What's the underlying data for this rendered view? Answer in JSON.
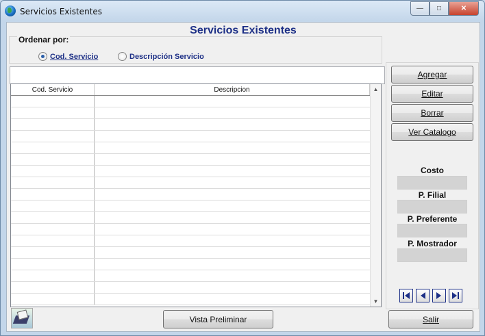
{
  "window": {
    "title": "Servicios Existentes"
  },
  "header": {
    "title": "Servicios Existentes"
  },
  "sort": {
    "label": "Ordenar por:",
    "options": [
      {
        "label": "Cod. Servicio",
        "selected": true
      },
      {
        "label": "Descripción Servicio",
        "selected": false
      }
    ]
  },
  "search": {
    "value": ""
  },
  "grid": {
    "columns": [
      "Cod. Servicio",
      "Descripcion"
    ],
    "rows": []
  },
  "actions": {
    "agregar": "Agregar",
    "editar": "Editar",
    "borrar": "Borrar",
    "ver_catalogo": "Ver Catalogo"
  },
  "prices": {
    "costo_label": "Costo",
    "filial_label": "P. Filial",
    "preferente_label": "P. Preferente",
    "mostrador_label": "P. Mostrador",
    "costo": "",
    "filial": "",
    "preferente": "",
    "mostrador": ""
  },
  "navigation": {
    "first_icon": "first-record-icon",
    "prev_icon": "previous-record-icon",
    "next_icon": "next-record-icon",
    "last_icon": "last-record-icon"
  },
  "footer": {
    "preview": "Vista Preliminar",
    "exit": "Salir",
    "print_icon": "print-icon"
  },
  "colors": {
    "title": "#1c2f86",
    "accent": "#1c2f86",
    "field_bg": "#d3d3d3"
  }
}
